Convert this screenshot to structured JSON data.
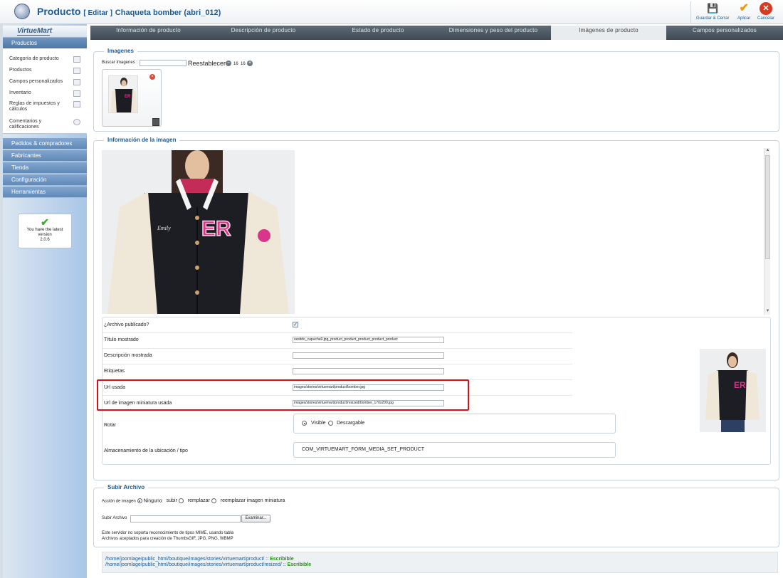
{
  "header": {
    "section": "Producto",
    "mode": "[ Editar ]",
    "product_name": "Chaqueta bomber (abri_012)",
    "toolbar": {
      "save_close": "Guardar & Cerrar",
      "apply": "Aplicar",
      "cancel": "Cancelar"
    }
  },
  "sidebar": {
    "logo_text": "VirtueMart",
    "header": "Productos",
    "items": [
      "Categoría de producto",
      "Productos",
      "Campos personalizados",
      "Inventario",
      "Reglas de impuestos y cálculos",
      "Comentarios y calificaciones"
    ],
    "sections": [
      "Pedidos & compradores",
      "Fabricantes",
      "Tienda",
      "Configuración",
      "Herramientas"
    ],
    "version": {
      "line1": "You have the latest",
      "line2": "version",
      "number": "2.0.6"
    }
  },
  "tabs": [
    "Información de producto",
    "Descripción de producto",
    "Estado de producto",
    "Dimensiones y peso del producto",
    "Imágenes de producto",
    "Campos personalizados"
  ],
  "active_tab": "Imágenes de producto",
  "images": {
    "legend": "Imagenes",
    "search_label": "Buscar Imagenes :",
    "search_value": "",
    "reset": "Reestablecer",
    "pager_left": "16",
    "pager_right": "16"
  },
  "image_info": {
    "legend": "Información de la imagen",
    "published_label": "¿Archivo publicado?",
    "published": true,
    "title_label": "Título mostrado",
    "title_value": "vestido_capucha9.jpg_product_product_product_product_product",
    "desc_label": "Descripción mostrada",
    "desc_value": "",
    "tags_label": "Etiquetas",
    "tags_value": "",
    "url_label": "Url usada",
    "url_value": "images/stories/virtuemart/product/bomber.jpg",
    "thumb_url_label": "Url de imagen miniatura usada",
    "thumb_url_value": "images/stories/virtuemart/product/resized/bomber_170x200.jpg",
    "rotate_label": "Rotar",
    "visible_label": "Visible",
    "download_label": "Descargable",
    "storage_label": "Almacenamiento de la ubicación / tipo",
    "storage_value": "COM_VIRTUEMART_FORM_MEDIA_SET_PRODUCT"
  },
  "upload": {
    "legend": "Subir Archivo",
    "action_label": "Acción de imagen",
    "options": [
      "Ninguno",
      "subir",
      "remplazar",
      "reemplazar imagen miniatura"
    ],
    "file_label": "Subir Archivo",
    "browse": "Examinar...",
    "note1": "Este servidor no soporta reconocimiento de tipos MIME, usando tabla",
    "note2": "Archivos aceptados para creación de ThumbsGIF, JPG, PNG, WBMP"
  },
  "paths": {
    "p1": "/home/joomlage/public_html/boutique/images/stories/virtuemart/product/",
    "p2": "/home/joomlage/public_html/boutique/images/stories/virtuemart/product/resized/",
    "sep": " :: ",
    "status": "Escribible"
  },
  "colors": {
    "accent": "#1d5a91",
    "highlight": "#d3111a",
    "ok": "#2d8b1f"
  }
}
